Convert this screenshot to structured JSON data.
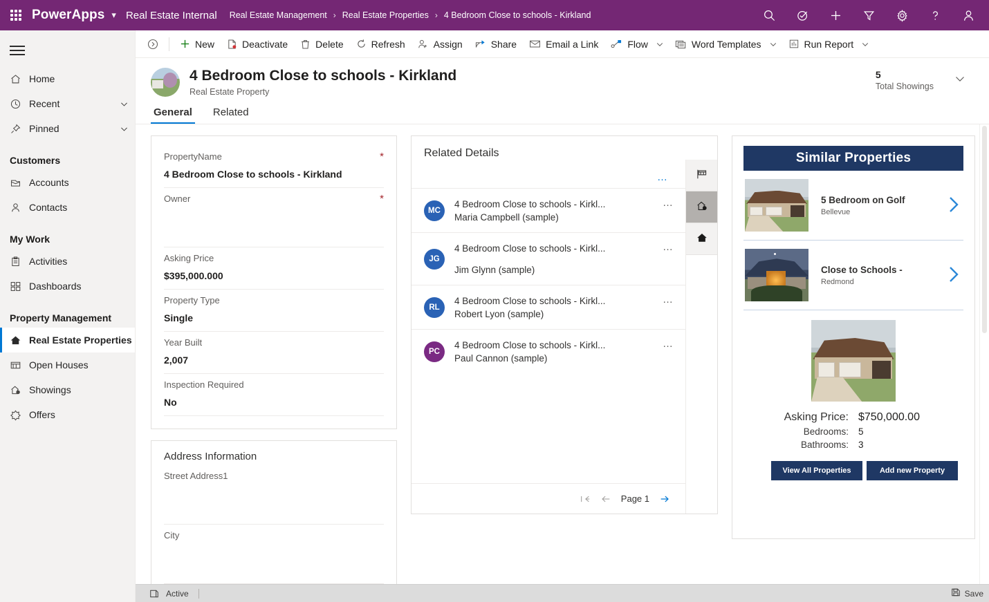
{
  "appbar": {
    "waffle": "app-launcher",
    "brand": "PowerApps",
    "app_name": "Real Estate Internal",
    "breadcrumbs": [
      "Real Estate Management",
      "Real Estate Properties",
      "4 Bedroom Close to schools - Kirkland"
    ],
    "icons": [
      "search-icon",
      "diagnostics-icon",
      "quick-create-icon",
      "filter-icon",
      "settings-icon",
      "help-icon",
      "user-icon"
    ],
    "color": "#742774"
  },
  "sidebar": {
    "top_items": [
      {
        "label": "Home",
        "icon": "home-icon",
        "chevron": false
      },
      {
        "label": "Recent",
        "icon": "clock-icon",
        "chevron": true
      },
      {
        "label": "Pinned",
        "icon": "pin-icon",
        "chevron": true
      }
    ],
    "groups": [
      {
        "title": "Customers",
        "items": [
          {
            "label": "Accounts",
            "icon": "accounts-icon"
          },
          {
            "label": "Contacts",
            "icon": "contact-icon"
          }
        ]
      },
      {
        "title": "My Work",
        "items": [
          {
            "label": "Activities",
            "icon": "activities-icon"
          },
          {
            "label": "Dashboards",
            "icon": "dashboards-icon"
          }
        ]
      },
      {
        "title": "Property Management",
        "items": [
          {
            "label": "Real Estate Properties",
            "icon": "house-icon",
            "selected": true
          },
          {
            "label": "Open Houses",
            "icon": "open-house-icon"
          },
          {
            "label": "Showings",
            "icon": "showings-icon"
          },
          {
            "label": "Offers",
            "icon": "offers-icon"
          }
        ]
      }
    ]
  },
  "commandbar": {
    "items": [
      {
        "label": "New",
        "icon": "plus-icon",
        "caret": false
      },
      {
        "label": "Deactivate",
        "icon": "deactivate-icon",
        "caret": false
      },
      {
        "label": "Delete",
        "icon": "trash-icon",
        "caret": false
      },
      {
        "label": "Refresh",
        "icon": "refresh-icon",
        "caret": false
      },
      {
        "label": "Assign",
        "icon": "assign-icon",
        "caret": false
      },
      {
        "label": "Share",
        "icon": "share-icon",
        "caret": false
      },
      {
        "label": "Email a Link",
        "icon": "email-link-icon",
        "caret": false
      },
      {
        "label": "Flow",
        "icon": "flow-icon",
        "caret": true
      },
      {
        "label": "Word Templates",
        "icon": "word-template-icon",
        "caret": true
      },
      {
        "label": "Run Report",
        "icon": "report-icon",
        "caret": true
      }
    ]
  },
  "record": {
    "title": "4 Bedroom Close to schools - Kirkland",
    "subtitle": "Real Estate Property",
    "kpi_value": "5",
    "kpi_label": "Total Showings"
  },
  "tabs": [
    {
      "label": "General",
      "active": true
    },
    {
      "label": "Related",
      "active": false
    }
  ],
  "form": {
    "fields": [
      {
        "label": "PropertyName",
        "value": "4 Bedroom Close to schools - Kirkland",
        "required": true,
        "tall": false
      },
      {
        "label": "Owner",
        "value": "",
        "required": true,
        "tall": true
      },
      {
        "label": "Asking Price",
        "value": "$395,000.000",
        "required": false,
        "tall": false
      },
      {
        "label": "Property Type",
        "value": "Single",
        "required": false,
        "tall": false
      },
      {
        "label": "Year Built",
        "value": "2,007",
        "required": false,
        "tall": false
      },
      {
        "label": "Inspection Required",
        "value": "No",
        "required": false,
        "tall": false
      }
    ],
    "address_section": {
      "title": "Address Information",
      "fields": [
        {
          "label": "Street Address1",
          "value": ""
        },
        {
          "label": "City",
          "value": ""
        }
      ]
    }
  },
  "related": {
    "title": "Related Details",
    "overflow": "•••",
    "items": [
      {
        "initials": "MC",
        "color": "#2a62b5",
        "line1": "4 Bedroom Close to schools - Kirkl...",
        "line2": "Maria Campbell (sample)"
      },
      {
        "initials": "JG",
        "color": "#2a62b5",
        "line1": "4 Bedroom Close to schools - Kirkl...",
        "line2": "Jim Glynn (sample)"
      },
      {
        "initials": "RL",
        "color": "#2a62b5",
        "line1": "4 Bedroom Close to schools - Kirkl...",
        "line2": "Robert Lyon (sample)"
      },
      {
        "initials": "PC",
        "color": "#7a2a83",
        "line1": "4 Bedroom Close to schools - Kirkl...",
        "line2": "Paul Cannon (sample)"
      }
    ],
    "pager": {
      "first": "first-page-icon",
      "prev": "previous-page-icon",
      "page_label": "Page 1",
      "next": "next-page-icon"
    },
    "vtabs": [
      {
        "icon": "open-house-sign-icon",
        "active": false
      },
      {
        "icon": "showings-icon",
        "active": true
      },
      {
        "icon": "home-icon",
        "active": false
      }
    ]
  },
  "similar": {
    "header": "Similar Properties",
    "header_color": "#1f3864",
    "rows": [
      {
        "name": "5 Bedroom on Golf",
        "city": "Bellevue",
        "photo": "day",
        "chevron": "chevron-right-icon"
      },
      {
        "name": "Close to Schools -",
        "city": "Redmond",
        "photo": "dusk",
        "chevron": "chevron-right-icon"
      }
    ],
    "detail_photo": "day",
    "stats": [
      {
        "label": "Asking Price:",
        "value": "$750,000.00",
        "big": true
      },
      {
        "label": "Bedrooms:",
        "value": "5",
        "big": false
      },
      {
        "label": "Bathrooms:",
        "value": "3",
        "big": false
      }
    ],
    "buttons": [
      {
        "label": "View All Properties"
      },
      {
        "label": "Add new Property"
      }
    ]
  },
  "statusbar": {
    "state_icon": "record-state-icon",
    "state": "Active",
    "save_icon": "save-icon",
    "save_label": "Save"
  }
}
